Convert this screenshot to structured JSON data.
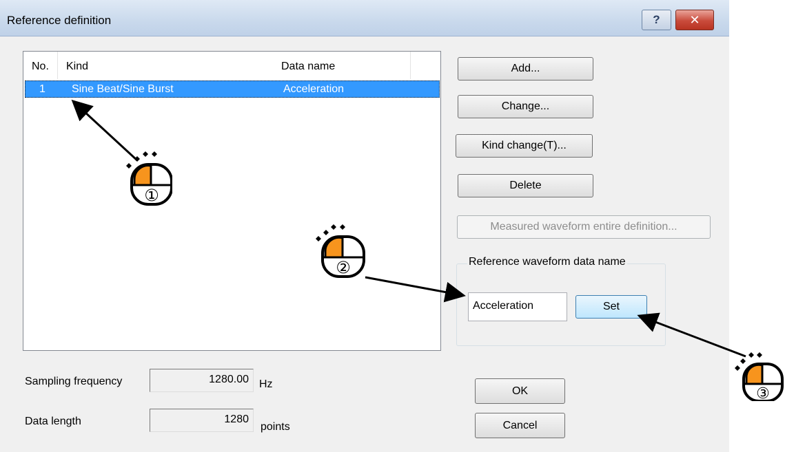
{
  "window": {
    "title": "Reference definition",
    "help_glyph": "?",
    "close_glyph": "✕"
  },
  "list": {
    "columns": [
      "No.",
      "Kind",
      "Data name"
    ],
    "rows": [
      {
        "no": "1",
        "kind": "Sine Beat/Sine Burst",
        "data_name": "Acceleration",
        "selected": true
      }
    ]
  },
  "buttons": {
    "add": "Add...",
    "change": "Change...",
    "kind_change": "Kind change(T)...",
    "delete": "Delete",
    "measured_all": "Measured waveform entire definition...",
    "set": "Set",
    "ok": "OK",
    "cancel": "Cancel"
  },
  "reference_group": {
    "label": "Reference waveform data name",
    "value": "Acceleration"
  },
  "sampling": {
    "label": "Sampling frequency",
    "value": "1280.00",
    "unit": "Hz"
  },
  "data_length": {
    "label": "Data length",
    "value": "1280",
    "unit": "points"
  },
  "annotations": {
    "step1": "①",
    "step2": "②",
    "step3": "③",
    "highlight_color": "#f7941d"
  }
}
